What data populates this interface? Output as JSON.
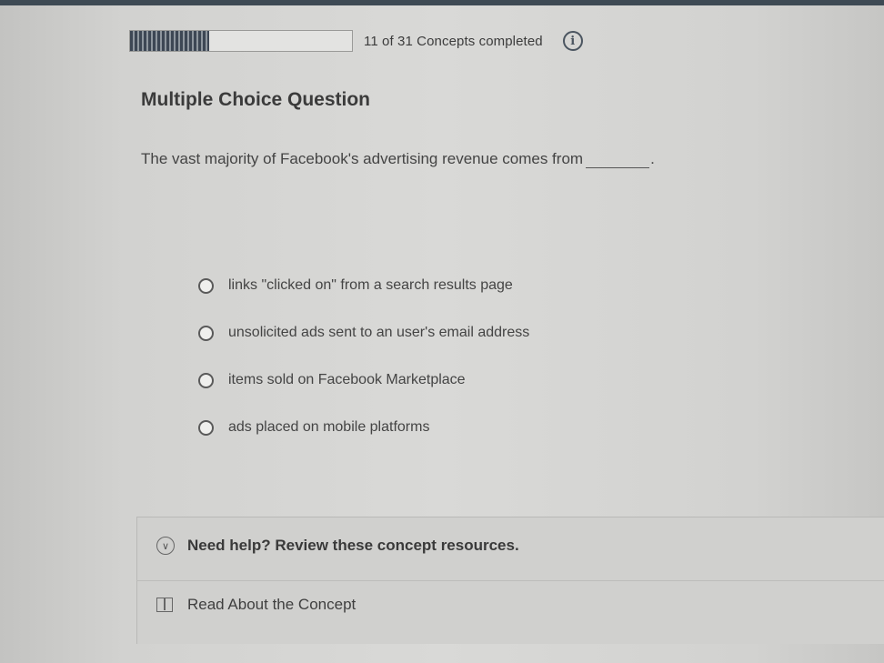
{
  "progress": {
    "fraction": 0.355,
    "label": "11 of 31 Concepts completed",
    "info_icon": "info-icon"
  },
  "question": {
    "heading": "Multiple Choice Question",
    "text": "The vast majority of Facebook's advertising revenue comes from",
    "end_punctuation": "."
  },
  "options": [
    {
      "label": "links \"clicked on\" from a search results page"
    },
    {
      "label": "unsolicited ads sent to an user's email address"
    },
    {
      "label": "items sold on Facebook Marketplace"
    },
    {
      "label": "ads placed on mobile platforms"
    }
  ],
  "help": {
    "toggle_icon": "chevron-down-icon",
    "label": "Need help? Review these concept resources.",
    "resource_icon": "book-icon",
    "resource_label": "Read About the Concept"
  },
  "colors": {
    "progress_fill": "#3d4754",
    "top_bar": "#3e4a54",
    "background": "#d9d9d7"
  }
}
